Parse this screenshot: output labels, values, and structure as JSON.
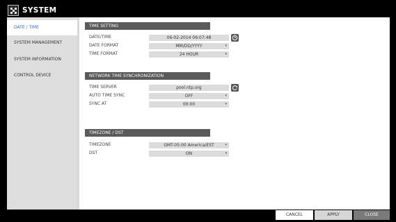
{
  "app": {
    "title": "SYSTEM"
  },
  "sidebar": {
    "items": [
      {
        "label": "DATE / TIME",
        "active": true
      },
      {
        "label": "SYSTEM MANAGEMENT"
      },
      {
        "label": "SYSTEM INFORMATION"
      },
      {
        "label": "CONTROL DEVICE"
      }
    ]
  },
  "time_setting": {
    "title": "TIME SETTING",
    "date_time_label": "DATE/TIME",
    "date_time_value": "06-02-2014 06:07:48",
    "date_format_label": "DATE FORMAT",
    "date_format_value": "MM/DD/YYYY",
    "time_format_label": "TIME FORMAT",
    "time_format_value": "24 HOUR"
  },
  "ntp": {
    "title": "NETWORK TIME SYNCHRONIZATION",
    "time_server_label": "TIME SERVER",
    "time_server_value": "pool.ntp.org",
    "auto_sync_label": "AUTO TIME SYNC",
    "auto_sync_value": "OFF",
    "sync_at_label": "SYNC AT",
    "sync_at_value": "00:00"
  },
  "timezone": {
    "title": "TIMEZONE / DST",
    "timezone_label": "TIMEZONE",
    "timezone_value": "GMT-05:00 America/EST",
    "dst_label": "DST",
    "dst_value": "ON"
  },
  "buttons": {
    "cancel": "CANCEL",
    "apply": "APPLY",
    "close": "CLOSE"
  },
  "icons": {
    "app": "system-gear-icon",
    "calendar": "calendar-edit-icon",
    "refresh": "refresh-icon",
    "dropdown": "chevron-down-icon"
  },
  "colors": {
    "active_nav_text": "#2e6bc6",
    "section_header_bg": "#5a5a5a",
    "value_field_bg": "#dcdcdc",
    "close_button_bg": "#7a7a7a"
  }
}
